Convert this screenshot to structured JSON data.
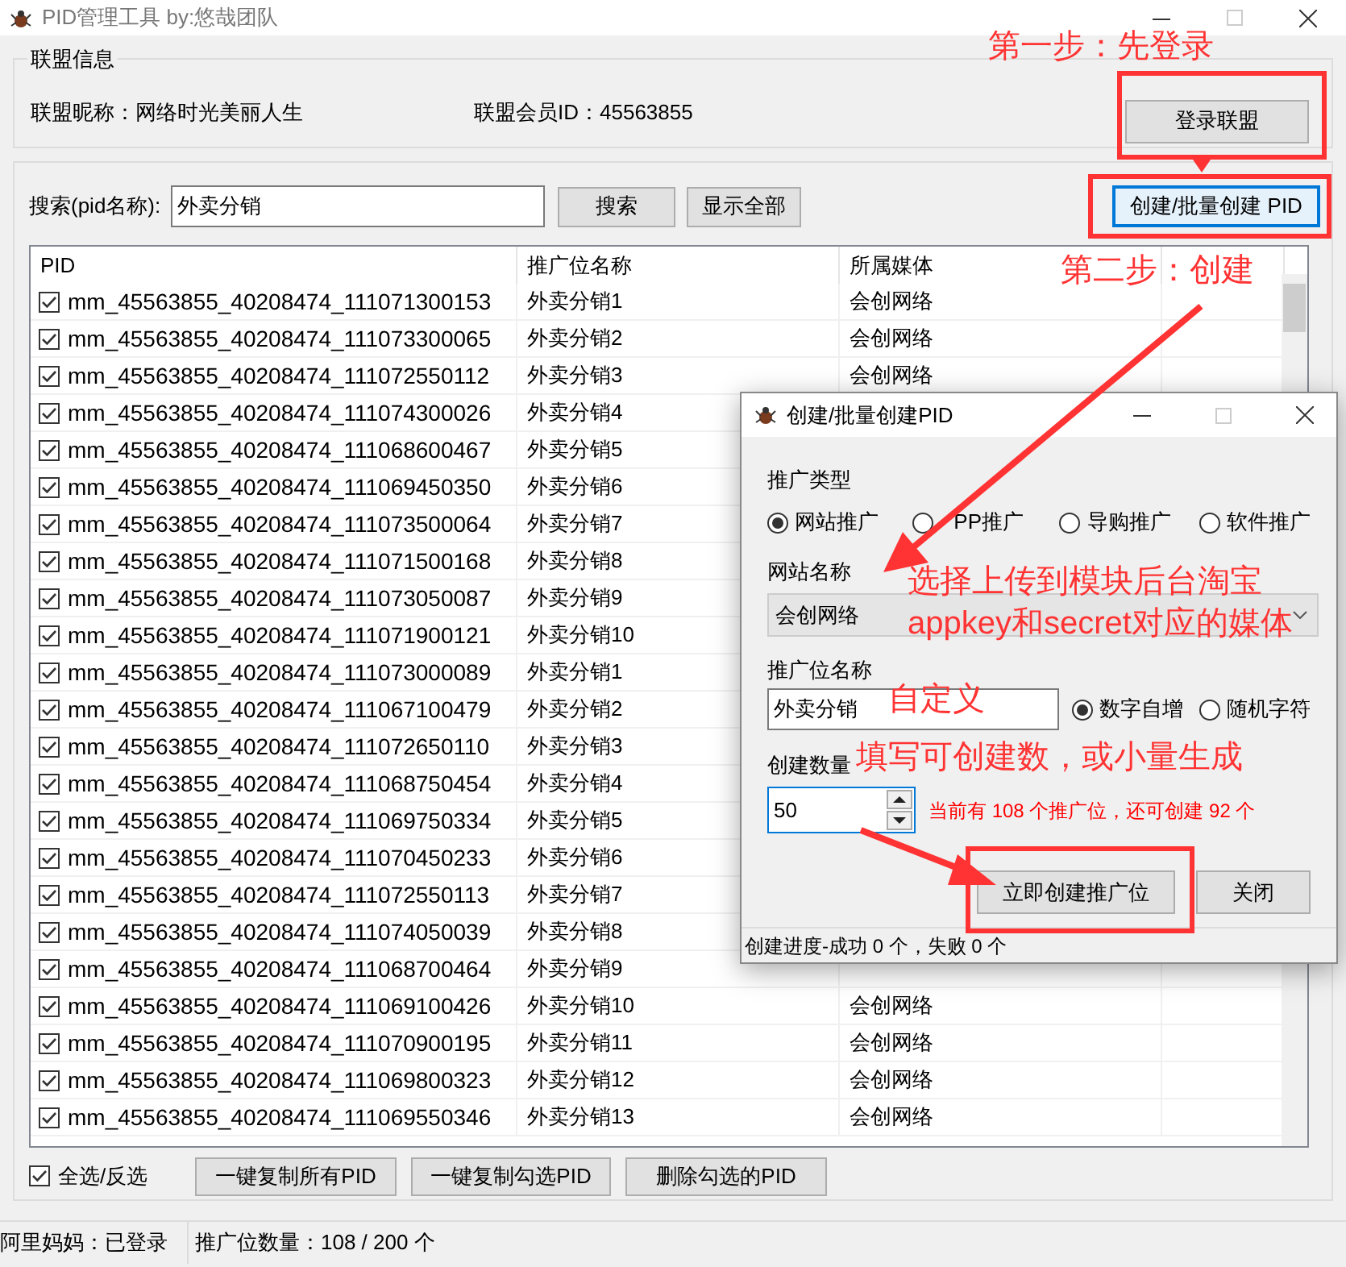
{
  "window": {
    "title": "PID管理工具  by:悠哉团队"
  },
  "alliance_info": {
    "legend": "联盟信息",
    "nickname_label": "联盟昵称：",
    "nickname": "网络时光美丽人生",
    "member_id_label": "联盟会员ID：",
    "member_id": "45563855",
    "login_button": "登录联盟"
  },
  "search": {
    "label": "搜索(pid名称):",
    "value": "外卖分销",
    "search_button": "搜索",
    "show_all_button": "显示全部",
    "create_button": "创建/批量创建 PID"
  },
  "table": {
    "columns": [
      "PID",
      "推广位名称",
      "所属媒体"
    ],
    "rows": [
      {
        "checked": true,
        "pid": "mm_45563855_40208474_111071300153",
        "name": "外卖分销1",
        "media": "会创网络"
      },
      {
        "checked": true,
        "pid": "mm_45563855_40208474_111073300065",
        "name": "外卖分销2",
        "media": "会创网络"
      },
      {
        "checked": true,
        "pid": "mm_45563855_40208474_111072550112",
        "name": "外卖分销3",
        "media": "会创网络"
      },
      {
        "checked": true,
        "pid": "mm_45563855_40208474_111074300026",
        "name": "外卖分销4"
      },
      {
        "checked": true,
        "pid": "mm_45563855_40208474_111068600467",
        "name": "外卖分销5"
      },
      {
        "checked": true,
        "pid": "mm_45563855_40208474_111069450350",
        "name": "外卖分销6"
      },
      {
        "checked": true,
        "pid": "mm_45563855_40208474_111073500064",
        "name": "外卖分销7"
      },
      {
        "checked": true,
        "pid": "mm_45563855_40208474_111071500168",
        "name": "外卖分销8"
      },
      {
        "checked": true,
        "pid": "mm_45563855_40208474_111073050087",
        "name": "外卖分销9"
      },
      {
        "checked": true,
        "pid": "mm_45563855_40208474_111071900121",
        "name": "外卖分销10"
      },
      {
        "checked": true,
        "pid": "mm_45563855_40208474_111073000089",
        "name": "外卖分销1"
      },
      {
        "checked": true,
        "pid": "mm_45563855_40208474_111067100479",
        "name": "外卖分销2"
      },
      {
        "checked": true,
        "pid": "mm_45563855_40208474_111072650110",
        "name": "外卖分销3"
      },
      {
        "checked": true,
        "pid": "mm_45563855_40208474_111068750454",
        "name": "外卖分销4"
      },
      {
        "checked": true,
        "pid": "mm_45563855_40208474_111069750334",
        "name": "外卖分销5"
      },
      {
        "checked": true,
        "pid": "mm_45563855_40208474_111070450233",
        "name": "外卖分销6"
      },
      {
        "checked": true,
        "pid": "mm_45563855_40208474_111072550113",
        "name": "外卖分销7"
      },
      {
        "checked": true,
        "pid": "mm_45563855_40208474_111074050039",
        "name": "外卖分销8"
      },
      {
        "checked": true,
        "pid": "mm_45563855_40208474_111068700464",
        "name": "外卖分销9"
      },
      {
        "checked": true,
        "pid": "mm_45563855_40208474_111069100426",
        "name": "外卖分销10",
        "media": "会创网络"
      },
      {
        "checked": true,
        "pid": "mm_45563855_40208474_111070900195",
        "name": "外卖分销11",
        "media": "会创网络"
      },
      {
        "checked": true,
        "pid": "mm_45563855_40208474_111069800323",
        "name": "外卖分销12",
        "media": "会创网络"
      },
      {
        "checked": true,
        "pid": "mm_45563855_40208474_111069550346",
        "name": "外卖分销13",
        "media": "会创网络"
      }
    ]
  },
  "footer": {
    "select_all": {
      "label": "全选/反选",
      "checked": true
    },
    "buttons": [
      "一键复制所有PID",
      "一键复制勾选PID",
      "删除勾选的PID"
    ]
  },
  "status_bar": [
    "阿里妈妈：已登录",
    "推广位数量：108 / 200 个"
  ],
  "dialog": {
    "title": "创建/批量创建PID",
    "type_label": "推广类型",
    "type_options": [
      {
        "label": "网站推广",
        "selected": true
      },
      {
        "label": "PP推广",
        "selected": false
      },
      {
        "label": "导购推广",
        "selected": false
      },
      {
        "label": "软件推广",
        "selected": false
      }
    ],
    "site_label": "网站名称",
    "site_value": "会创网络",
    "slot_label": "推广位名称",
    "slot_value": "外卖分销",
    "suffix_options": [
      {
        "label": "数字自增",
        "selected": true
      },
      {
        "label": "随机字符",
        "selected": false
      }
    ],
    "count_label": "创建数量",
    "count_value": "50",
    "hint": "当前有 108 个推广位，还可创建 92 个",
    "create_button": "立即创建推广位",
    "close_button": "关闭",
    "status": "创建进度-成功 0 个，失败 0 个"
  },
  "annotations": [
    {
      "text": "第一步：先登录"
    },
    {
      "text": "第二步：创建"
    },
    {
      "text": "选择上传到模块后台淘宝\nappkey和secret对应的媒体"
    },
    {
      "text": "自定义"
    },
    {
      "text": "填写可创建数，或小量生成"
    }
  ]
}
